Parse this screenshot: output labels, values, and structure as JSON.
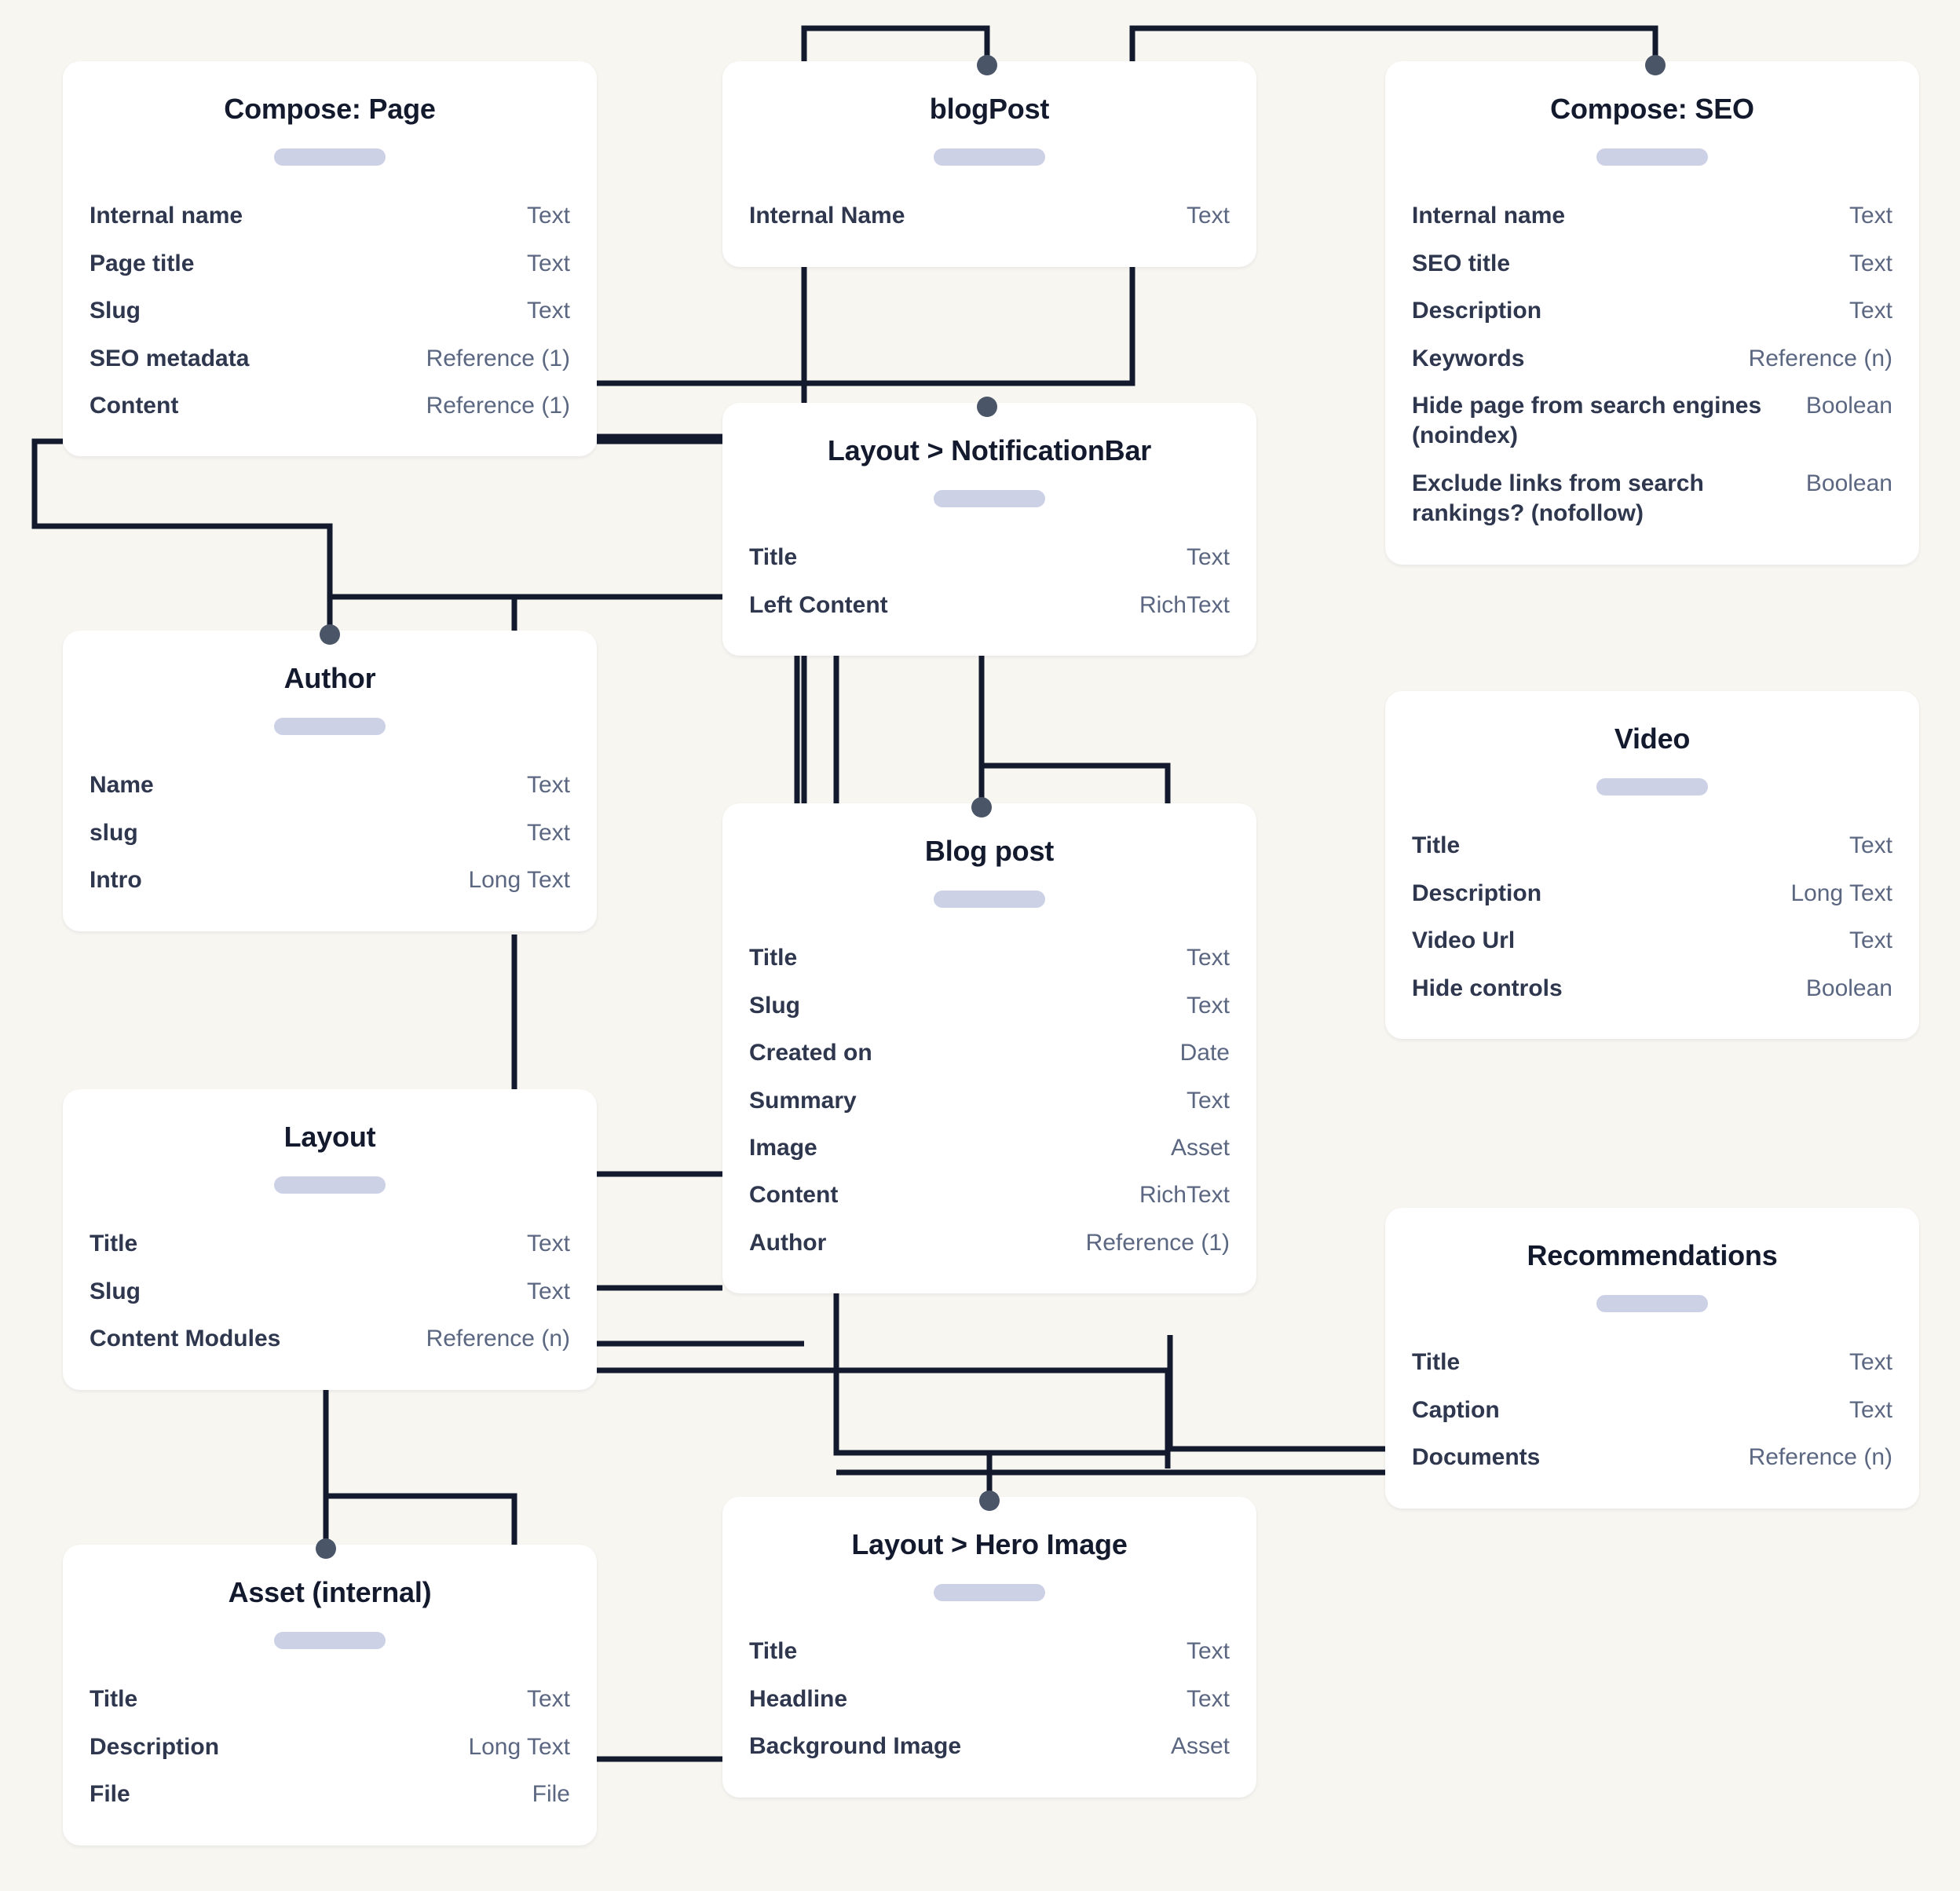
{
  "theme": {
    "background": "#f8f6f1",
    "card_background": "#ffffff",
    "title_color": "#141a2e",
    "field_name_color": "#2e374e",
    "field_type_color": "#5b6781",
    "connector_color": "#141a2e",
    "connector_dot_color": "#4a5568",
    "pill_color": "#ccd1e5"
  },
  "cards": {
    "compose_page": {
      "title": "Compose: Page",
      "fields": [
        {
          "name": "Internal name",
          "type": "Text"
        },
        {
          "name": "Page title",
          "type": "Text"
        },
        {
          "name": "Slug",
          "type": "Text"
        },
        {
          "name": "SEO metadata",
          "type": "Reference (1)"
        },
        {
          "name": "Content",
          "type": "Reference (1)"
        }
      ]
    },
    "blogpost": {
      "title": "blogPost",
      "fields": [
        {
          "name": "Internal Name",
          "type": "Text"
        }
      ]
    },
    "compose_seo": {
      "title": "Compose: SEO",
      "fields": [
        {
          "name": "Internal name",
          "type": "Text"
        },
        {
          "name": "SEO title",
          "type": "Text"
        },
        {
          "name": "Description",
          "type": "Text"
        },
        {
          "name": "Keywords",
          "type": "Reference (n)"
        },
        {
          "name": "Hide page from search engines (noindex)",
          "type": "Boolean"
        },
        {
          "name": "Exclude links from search rankings? (nofollow)",
          "type": "Boolean"
        }
      ]
    },
    "notificationbar": {
      "title": "Layout > NotificationBar",
      "fields": [
        {
          "name": "Title",
          "type": "Text"
        },
        {
          "name": "Left Content",
          "type": "RichText"
        }
      ]
    },
    "author": {
      "title": "Author",
      "fields": [
        {
          "name": "Name",
          "type": "Text"
        },
        {
          "name": "slug",
          "type": "Text"
        },
        {
          "name": "Intro",
          "type": "Long Text"
        }
      ]
    },
    "video": {
      "title": "Video",
      "fields": [
        {
          "name": "Title",
          "type": "Text"
        },
        {
          "name": "Description",
          "type": "Long Text"
        },
        {
          "name": "Video Url",
          "type": "Text"
        },
        {
          "name": "Hide controls",
          "type": "Boolean"
        }
      ]
    },
    "blog_post": {
      "title": "Blog post",
      "fields": [
        {
          "name": "Title",
          "type": "Text"
        },
        {
          "name": "Slug",
          "type": "Text"
        },
        {
          "name": "Created on",
          "type": "Date"
        },
        {
          "name": "Summary",
          "type": "Text"
        },
        {
          "name": "Image",
          "type": "Asset"
        },
        {
          "name": "Content",
          "type": "RichText"
        },
        {
          "name": "Author",
          "type": "Reference (1)"
        }
      ]
    },
    "layout": {
      "title": "Layout",
      "fields": [
        {
          "name": "Title",
          "type": "Text"
        },
        {
          "name": "Slug",
          "type": "Text"
        },
        {
          "name": "Content Modules",
          "type": "Reference (n)"
        }
      ]
    },
    "recommendations": {
      "title": "Recommendations",
      "fields": [
        {
          "name": "Title",
          "type": "Text"
        },
        {
          "name": "Caption",
          "type": "Text"
        },
        {
          "name": "Documents",
          "type": "Reference (n)"
        }
      ]
    },
    "hero_image": {
      "title": "Layout > Hero Image",
      "fields": [
        {
          "name": "Title",
          "type": "Text"
        },
        {
          "name": "Headline",
          "type": "Text"
        },
        {
          "name": "Background Image",
          "type": "Asset"
        }
      ]
    },
    "asset_internal": {
      "title": "Asset (internal)",
      "fields": [
        {
          "name": "Title",
          "type": "Text"
        },
        {
          "name": "Description",
          "type": "Long Text"
        },
        {
          "name": "File",
          "type": "File"
        }
      ]
    }
  }
}
